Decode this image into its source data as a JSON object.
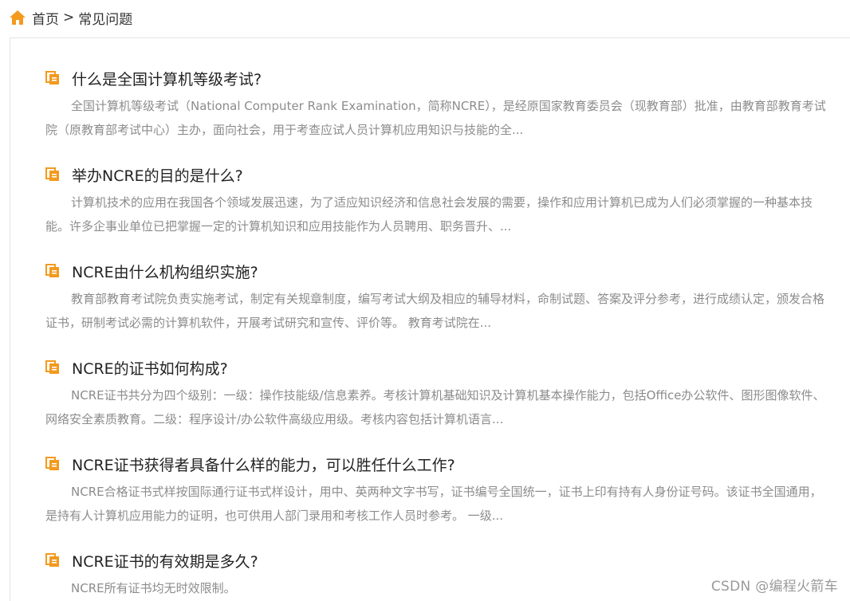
{
  "breadcrumb": {
    "home": "首页",
    "separator": ">",
    "current": "常见问题"
  },
  "faq": [
    {
      "title": "什么是全国计算机等级考试?",
      "summary": "全国计算机等级考试（National Computer Rank Examination，简称NCRE），是经原国家教育委员会（现教育部）批准，由教育部教育考试院（原教育部考试中心）主办，面向社会，用于考查应试人员计算机应用知识与技能的全..."
    },
    {
      "title": "举办NCRE的目的是什么?",
      "summary": "计算机技术的应用在我国各个领域发展迅速，为了适应知识经济和信息社会发展的需要，操作和应用计算机已成为人们必须掌握的一种基本技能。许多企事业单位已把掌握一定的计算机知识和应用技能作为人员聘用、职务晋升、..."
    },
    {
      "title": "NCRE由什么机构组织实施?",
      "summary": "教育部教育考试院负责实施考试，制定有关规章制度，编写考试大纲及相应的辅导材料，命制试题、答案及评分参考，进行成绩认定，颁发合格证书，研制考试必需的计算机软件，开展考试研究和宣传、评价等。 教育考试院在..."
    },
    {
      "title": "NCRE的证书如何构成?",
      "summary": "NCRE证书共分为四个级别：一级：操作技能级/信息素养。考核计算机基础知识及计算机基本操作能力，包括Office办公软件、图形图像软件、网络安全素质教育。二级：程序设计/办公软件高级应用级。考核内容包括计算机语言..."
    },
    {
      "title": "NCRE证书获得者具备什么样的能力，可以胜任什么工作?",
      "summary": "NCRE合格证书式样按国际通行证书式样设计，用中、英两种文字书写，证书编号全国统一，证书上印有持有人身份证号码。该证书全国通用，是持有人计算机应用能力的证明，也可供用人部门录用和考核工作人员时参考。 一级..."
    },
    {
      "title": "NCRE证书的有效期是多久?",
      "summary": "NCRE所有证书均无时效限制。"
    }
  ],
  "watermark": "CSDN @编程火箭车",
  "colors": {
    "icon": "#f39a1e",
    "title": "#222222",
    "summary": "#8c8c8c",
    "border": "#e3e3e3"
  },
  "icons": {
    "home": "home-icon",
    "item": "document-icon"
  }
}
